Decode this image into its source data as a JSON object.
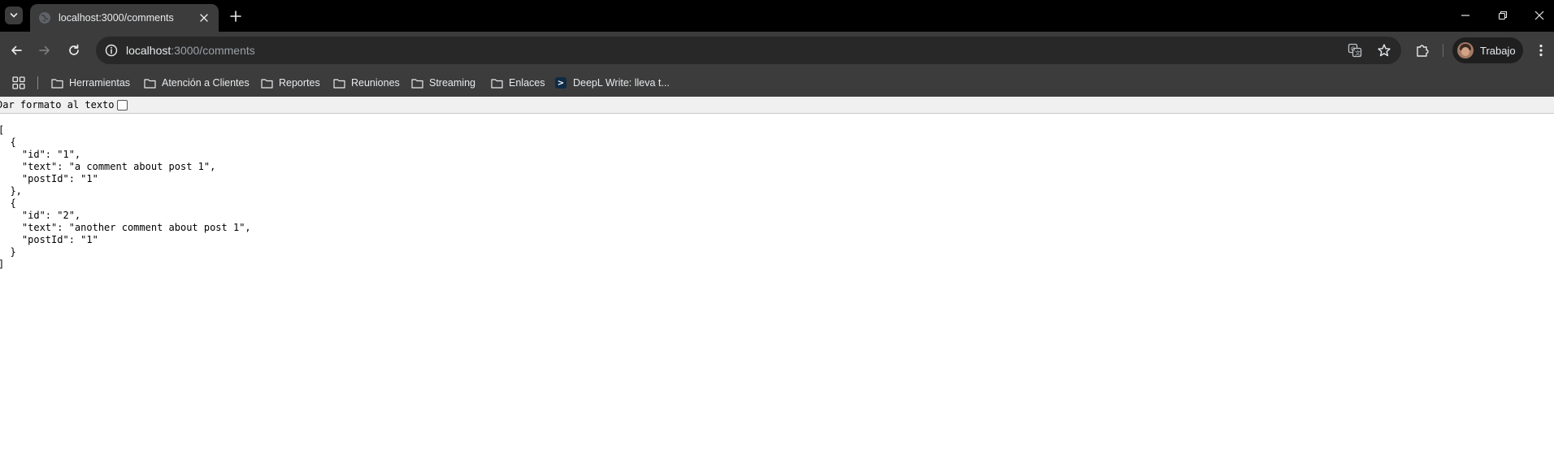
{
  "tab": {
    "title": "localhost:3000/comments"
  },
  "address_bar": {
    "host": "localhost",
    "path": ":3000/comments"
  },
  "profile": {
    "name": "Trabajo"
  },
  "bookmarks": [
    {
      "label": "Herramientas",
      "icon": "folder-icon"
    },
    {
      "label": "Atención a Clientes",
      "icon": "folder-icon"
    },
    {
      "label": "Reportes",
      "icon": "folder-icon"
    },
    {
      "label": "Reuniones",
      "icon": "folder-icon"
    },
    {
      "label": "Streaming",
      "icon": "folder-icon"
    },
    {
      "label": "Enlaces",
      "icon": "folder-icon"
    },
    {
      "label": "DeepL Write: lleva t...",
      "icon": "deepl-icon"
    }
  ],
  "page": {
    "format_label": "Dar formato al texto",
    "format_checked": false,
    "json_text": "[\n  {\n    \"id\": \"1\",\n    \"text\": \"a comment about post 1\",\n    \"postId\": \"1\"\n  },\n  {\n    \"id\": \"2\",\n    \"text\": \"another comment about post 1\",\n    \"postId\": \"1\"\n  }\n]"
  },
  "colors": {
    "titlebar": "#000000",
    "toolbar": "#3c3c3c",
    "omnibox": "#282828",
    "text_light": "#e8eaed",
    "text_dim": "#9aa0a6"
  }
}
